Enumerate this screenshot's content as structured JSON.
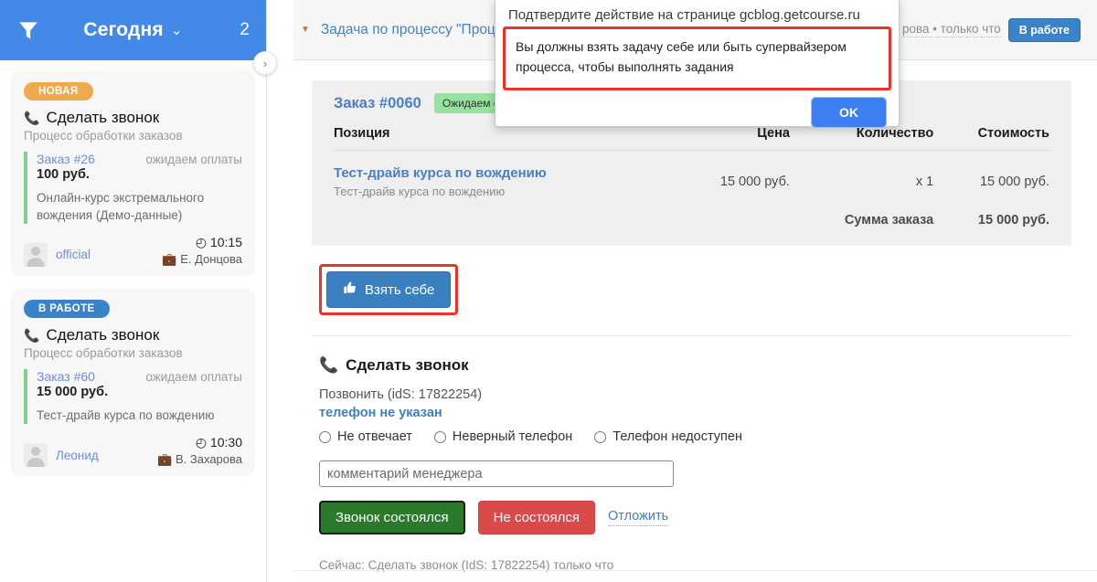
{
  "sidebar": {
    "filter_icon": "funnel-icon",
    "title": "Сегодня",
    "chevron": "⌄",
    "count": "2",
    "collapse_icon": "›",
    "cards": [
      {
        "badge": "НОВАЯ",
        "badge_kind": "new",
        "title": "Сделать звонок",
        "subtitle": "Процесс обработки заказов",
        "order_no": "Заказ #26",
        "order_state": "ожидаем оплаты",
        "amount": "100 руб.",
        "product": "Онлайн-курс экстремального вождения (Демо-данные)",
        "user": "official",
        "time": "10:15",
        "manager": "Е. Донцова"
      },
      {
        "badge": "В РАБОТЕ",
        "badge_kind": "work",
        "title": "Сделать звонок",
        "subtitle": "Процесс обработки заказов",
        "order_no": "Заказ #60",
        "order_state": "ожидаем оплаты",
        "amount": "15 000 руб.",
        "product": "Тест-драйв курса по вождению",
        "user": "Леонид",
        "time": "10:30",
        "manager": "В. Захарова"
      }
    ]
  },
  "topbar": {
    "triangle_icon": "triangle-down-icon",
    "title": "Задача по процессу \"Процесс обработки заказов\"",
    "meta": "рова • только что",
    "status_badge": "В работе"
  },
  "order_panel": {
    "order_no": "Заказ #0060",
    "status_badge": "Ожидаем оплаты",
    "columns": [
      "Позиция",
      "Цена",
      "Количество",
      "Стоимость"
    ],
    "rows": [
      {
        "name": "Тест-драйв курса по вождению",
        "desc": "Тест-драйв курса по вождению",
        "price": "15 000 руб.",
        "qty": "x 1",
        "total": "15 000 руб."
      }
    ],
    "sum_label": "Сумма заказа",
    "sum_value": "15 000 руб."
  },
  "take_button": {
    "icon": "thumbs-up-icon",
    "label": "Взять себе"
  },
  "call_form": {
    "phone_icon": "phone-icon",
    "title": "Сделать звонок",
    "call_line": "Позвонить (idS: 17822254)",
    "no_phone": "телефон не указан",
    "radios": [
      "Не отвечает",
      "Неверный телефон",
      "Телефон недоступен"
    ],
    "comment_placeholder": "комментарий менеджера",
    "comment_value": "",
    "btn_success": "Звонок состоялся",
    "btn_fail": "Не состоялся",
    "btn_postpone": "Отложить",
    "now_line": "Сейчас: Сделать звонок (IdS: 17822254) только что"
  },
  "dialog": {
    "title": "Подтвердите действие на странице gcblog.getcourse.ru",
    "message": "Вы должны взять задачу себе или быть супервайзером процесса, чтобы выполнять задания",
    "ok_label": "OK",
    "highlight_color": "#e8342a"
  },
  "colors": {
    "header_blue": "#4289e8",
    "accent_blue": "#3a7fbf",
    "badge_new": "#edab4d",
    "badge_work": "#3a83c9",
    "success_green": "#2b7a2b",
    "danger_red": "#da4a4a",
    "status_green": "#96e3a0",
    "panel_grey": "#efefef"
  }
}
